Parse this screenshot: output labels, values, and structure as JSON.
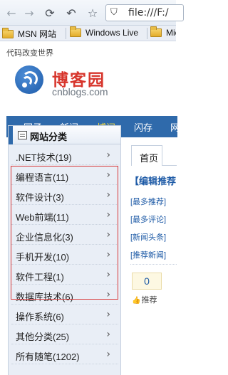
{
  "browser": {
    "url": "file:///F:/",
    "bookmarks": [
      {
        "label": "MSN 网站"
      },
      {
        "label": "Windows Live"
      },
      {
        "label": "Mic"
      }
    ]
  },
  "site": {
    "slogan": "代码改变世界",
    "logo_cn": "博客园",
    "logo_en": "cnblogs.com"
  },
  "nav": {
    "items": [
      {
        "label": "园子"
      },
      {
        "label": "新闻"
      },
      {
        "label": "博问"
      },
      {
        "label": "闪存"
      },
      {
        "label": "网"
      }
    ]
  },
  "sidebar": {
    "title": "网站分类",
    "items": [
      {
        "label": ".NET技术(19)"
      },
      {
        "label": "编程语言(11)"
      },
      {
        "label": "软件设计(3)"
      },
      {
        "label": "Web前端(11)"
      },
      {
        "label": "企业信息化(3)"
      },
      {
        "label": "手机开发(10)"
      },
      {
        "label": "软件工程(1)"
      },
      {
        "label": "数据库技术(6)"
      },
      {
        "label": "操作系统(6)"
      },
      {
        "label": "其他分类(25)"
      },
      {
        "label": "所有随笔(1202)"
      }
    ],
    "arrow": "›"
  },
  "content": {
    "tab_home": "首页",
    "editor_pick": "【编辑推荐",
    "links": [
      {
        "label": "[最多推荐]"
      },
      {
        "label": "[最多评论]"
      },
      {
        "label": "[新闻头条]"
      },
      {
        "label": "[推荐新闻]"
      }
    ],
    "vote_count": "0",
    "vote_label": "推荐"
  }
}
